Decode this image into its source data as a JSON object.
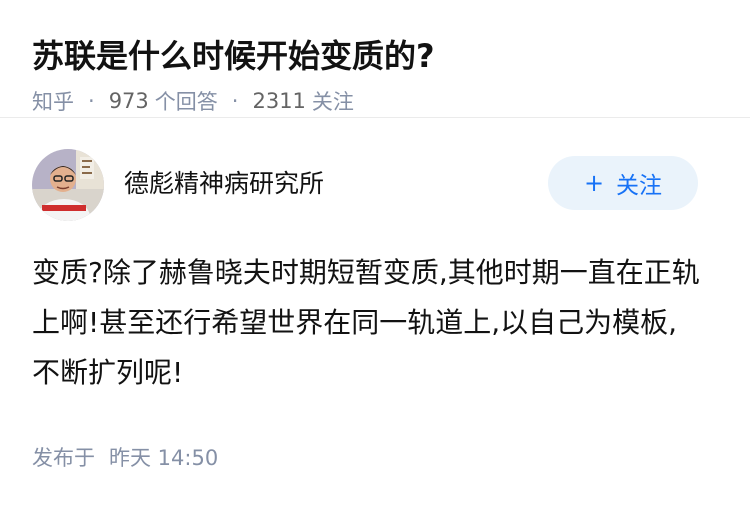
{
  "question": {
    "title": "苏联是什么时候开始变质的?",
    "source": "知乎",
    "answer_count": "973",
    "answer_label": "个回答",
    "follow_count": "2311",
    "follow_label": "关注"
  },
  "answer": {
    "author_name": "德彪精神病研究所",
    "follow_button": "关注",
    "follow_icon": "plus-icon",
    "content": "变质?除了赫鲁晓夫时期短暂变质,其他时期一直在正轨上啊!甚至还行希望世界在同一轨道上,以自己为模板,不断扩列呢!",
    "published_label": "发布于",
    "published_time": "昨天 14:50"
  },
  "colors": {
    "accent": "#1772f6",
    "accent_bg": "#eaf3fb",
    "meta": "#8590a6"
  }
}
